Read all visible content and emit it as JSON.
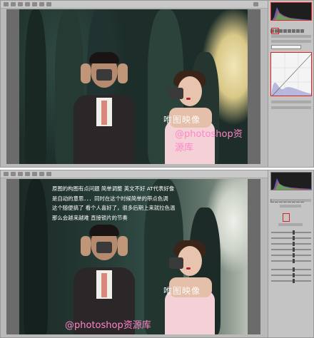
{
  "top": {
    "watermark": "@photoshop资源库",
    "stamp": "唯图映像"
  },
  "bottom": {
    "caption_lines": [
      "原图的构图有点问题 简单调整 英文不好 AT代表好像",
      "是自动的意思．．．同时在这个时候简单的带点色调",
      "这个随便搞了 看个人喜好了，很多后期上来就拉色温",
      "那么会越来越难 直接锁片的节奏"
    ],
    "watermark": "@photoshop资源库",
    "stamp": "唯图映像"
  },
  "colors": {
    "highlight": "#e02020",
    "watermark": "#ff86c6",
    "panel_bg": "#c4c4c4"
  },
  "icons": [
    "zoom-icon",
    "hand-icon",
    "white-balance-icon",
    "crop-icon",
    "rotate-icon",
    "histogram",
    "curve-graph"
  ]
}
